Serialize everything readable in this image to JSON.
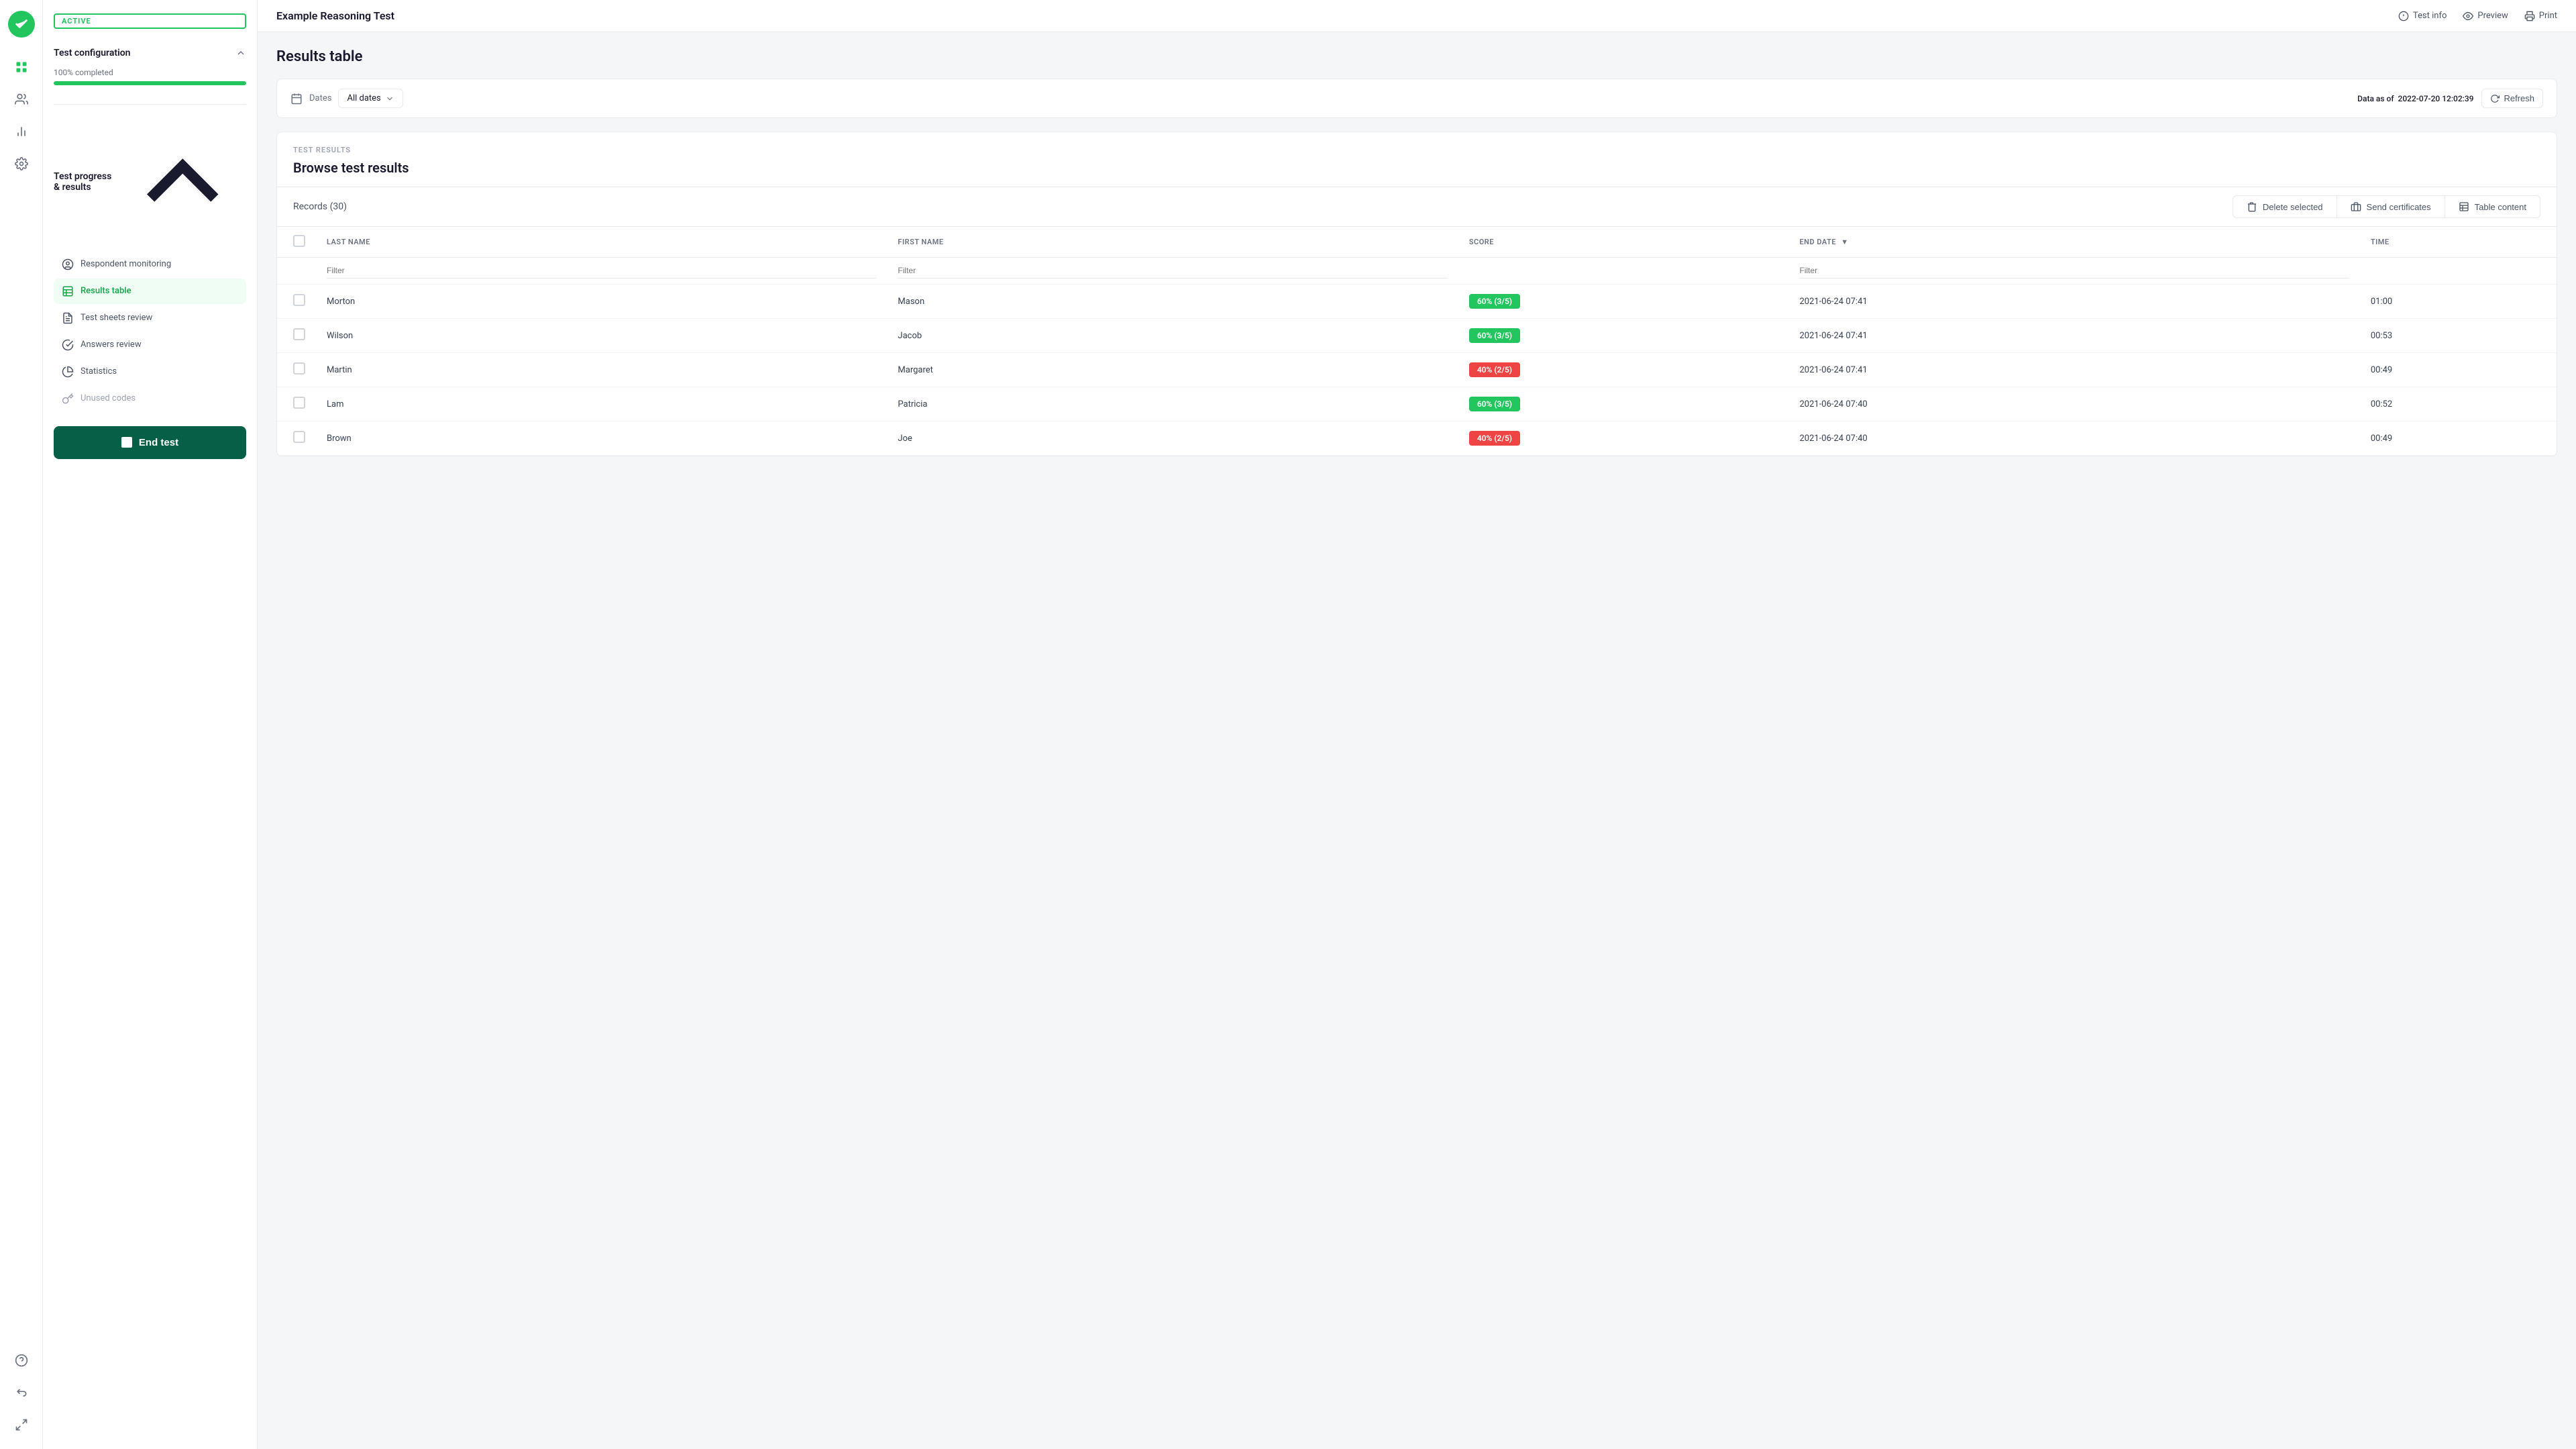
{
  "app": {
    "title": "Example Reasoning Test",
    "status": "ACTIVE"
  },
  "topbar": {
    "test_info": "Test info",
    "preview": "Preview",
    "print": "Print"
  },
  "sidebar": {
    "test_config": {
      "label": "Test configuration",
      "progress_label": "100% completed",
      "progress_value": 100
    },
    "nav": {
      "section_label": "Test progress & results",
      "items": [
        {
          "id": "respondent-monitoring",
          "label": "Respondent monitoring",
          "icon": "monitor"
        },
        {
          "id": "results-table",
          "label": "Results table",
          "icon": "chart",
          "active": true
        },
        {
          "id": "test-sheets-review",
          "label": "Test sheets review",
          "icon": "file-list"
        },
        {
          "id": "answers-review",
          "label": "Answers review",
          "icon": "check-circle"
        },
        {
          "id": "statistics",
          "label": "Statistics",
          "icon": "pie-chart"
        },
        {
          "id": "unused-codes",
          "label": "Unused codes",
          "icon": "key",
          "disabled": true
        }
      ]
    },
    "end_test_btn": "End test"
  },
  "main": {
    "page_title": "Results table",
    "filter_bar": {
      "dates_label": "Dates",
      "dates_value": "All dates",
      "data_as_of_label": "Data as of",
      "data_as_of_value": "2022-07-20 12:02:39",
      "refresh_label": "Refresh"
    },
    "results": {
      "section_label": "TEST RESULTS",
      "browse_title": "Browse test results",
      "records_label": "Records (30)",
      "actions": {
        "delete": "Delete selected",
        "send_certificates": "Send certificates",
        "table_content": "Table content"
      },
      "table": {
        "columns": [
          "LAST NAME",
          "FIRST NAME",
          "SCORE",
          "END DATE",
          "TIME"
        ],
        "filter_placeholders": [
          "Filter",
          "Filter",
          "",
          "Filter",
          ""
        ],
        "rows": [
          {
            "last_name": "Morton",
            "first_name": "Mason",
            "score": "60% (3/5)",
            "score_color": "green",
            "end_date": "2021-06-24 07:41",
            "time": "01:00"
          },
          {
            "last_name": "Wilson",
            "first_name": "Jacob",
            "score": "60% (3/5)",
            "score_color": "green",
            "end_date": "2021-06-24 07:41",
            "time": "00:53"
          },
          {
            "last_name": "Martin",
            "first_name": "Margaret",
            "score": "40% (2/5)",
            "score_color": "red",
            "end_date": "2021-06-24 07:41",
            "time": "00:49"
          },
          {
            "last_name": "Lam",
            "first_name": "Patricia",
            "score": "60% (3/5)",
            "score_color": "green",
            "end_date": "2021-06-24 07:40",
            "time": "00:52"
          },
          {
            "last_name": "Brown",
            "first_name": "Joe",
            "score": "40% (2/5)",
            "score_color": "red",
            "end_date": "2021-06-24 07:40",
            "time": "00:49"
          }
        ]
      }
    }
  }
}
